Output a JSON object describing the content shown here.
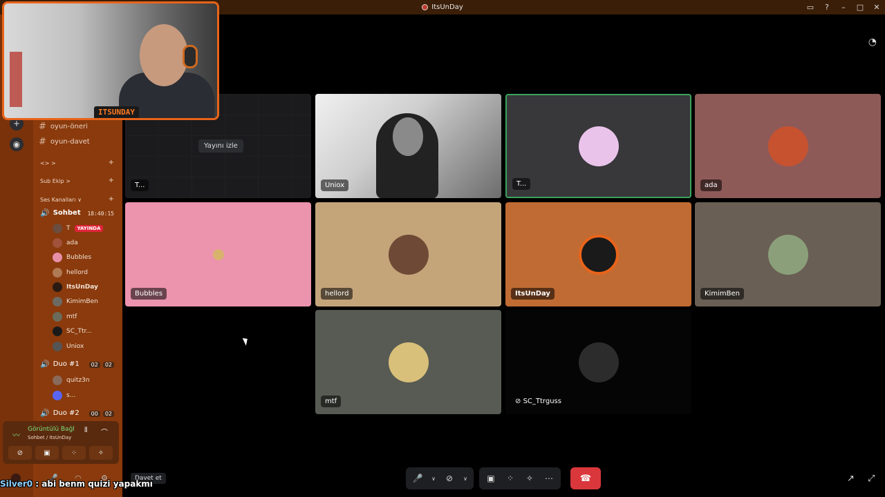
{
  "window": {
    "title": "ItsUnDay"
  },
  "sidebar": {
    "text_channels": [
      {
        "name": "oyun-öneri"
      },
      {
        "name": "oyun-davet"
      }
    ],
    "categories": [
      {
        "label": "<> >"
      },
      {
        "label": "Sub Ekip >"
      },
      {
        "label": "Ses Kanalları ∨"
      }
    ],
    "voice_channels": [
      {
        "name": "Sohbet",
        "time": "18:40:15",
        "users": [
          {
            "name": "T",
            "live": "YAYINDA",
            "color": "#6b4d3f"
          },
          {
            "name": "ada",
            "color": "#a0523a"
          },
          {
            "name": "Bubbles",
            "color": "#e88fa8"
          },
          {
            "name": "hellord",
            "color": "#b07a55"
          },
          {
            "name": "ItsUnDay",
            "color": "#2a1a12"
          },
          {
            "name": "KimimBen",
            "color": "#6c6a62"
          },
          {
            "name": "mtf",
            "color": "#6b6b5a"
          },
          {
            "name": "SC_Ttr...",
            "color": "#1a1a1a"
          },
          {
            "name": "Uniox",
            "color": "#555555"
          }
        ]
      },
      {
        "name": "Duo #1",
        "counts": [
          "02",
          "02"
        ],
        "users": [
          {
            "name": "quitz3n",
            "color": "#8a6a5a"
          },
          {
            "name": "s...",
            "color": "#5865f2"
          }
        ]
      },
      {
        "name": "Duo #2",
        "counts": [
          "00",
          "02"
        ]
      }
    ]
  },
  "voice_panel": {
    "status": "Görüntülü Bağl",
    "sub": "Sohbet / ItsUnDay"
  },
  "invite_label": "Davet et",
  "stream_tile": {
    "label": "T...",
    "watch": "Yayını izle"
  },
  "tiles": [
    {
      "label": "Uniox",
      "bg": "#cfcfcf"
    },
    {
      "label": "T...",
      "bg": "#38373a",
      "border": "#3ba55d"
    },
    {
      "label": "ada",
      "bg": "#8e5a58"
    },
    {
      "label": "Bubbles",
      "bg": "#ec94ad"
    },
    {
      "label": "hellord",
      "bg": "#c4a57a"
    },
    {
      "label": "ItsUnDay",
      "bg": "#c06b33"
    },
    {
      "label": "KimimBen",
      "bg": "#6a5f54"
    },
    {
      "label": "mtf",
      "bg": "#585b53"
    },
    {
      "label": "SC_Ttrguss",
      "bg": "#050505"
    }
  ],
  "webcam": {
    "brand": "ITSUNDAY"
  },
  "chat": {
    "user": "Silver0",
    "message": " : abi benm quizi yapakmı"
  },
  "icons": {
    "mic": "mic-icon",
    "camera": "camera-off-icon",
    "screenshare": "screen-share-icon",
    "activities": "activities-icon",
    "soundboard": "soundboard-icon",
    "more": "more-icon",
    "leave": "leave-call-icon"
  }
}
